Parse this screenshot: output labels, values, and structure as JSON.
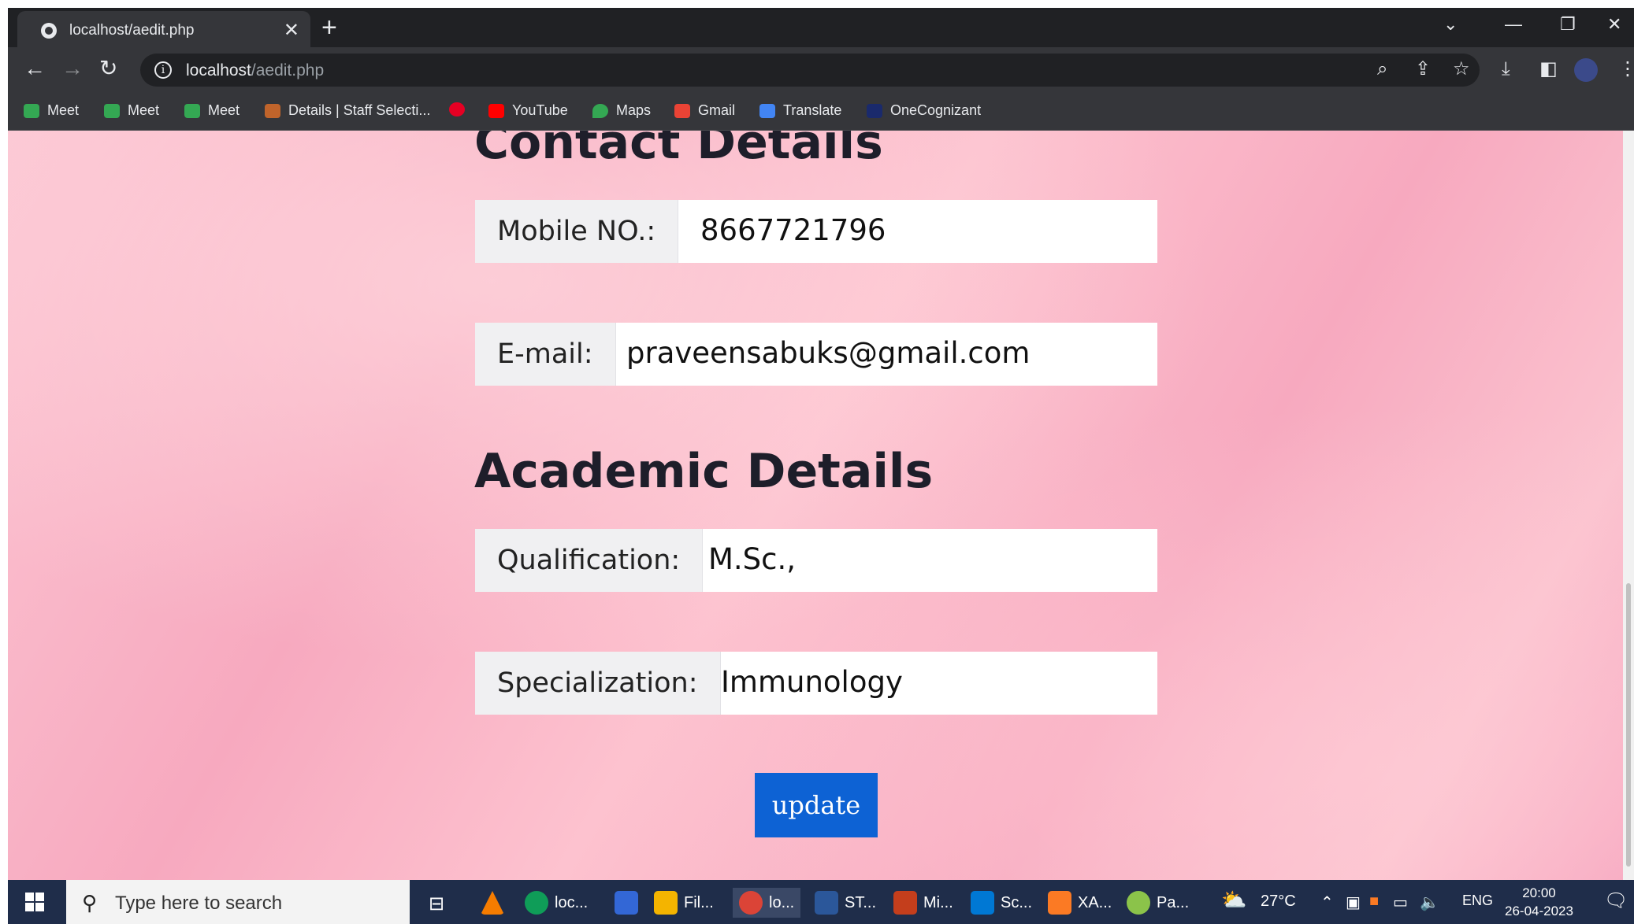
{
  "browser": {
    "tab_title": "localhost/aedit.php",
    "tab_close": "✕",
    "new_tab": "+",
    "url_host": "localhost",
    "url_path": "/aedit.php",
    "window_controls": {
      "tab_search": "⌄",
      "minimize": "—",
      "restore": "❐",
      "close": "✕"
    },
    "toolbar_icons": [
      "zoom-icon",
      "share-icon",
      "star-icon",
      "download-icon",
      "sidebar-icon",
      "profile-avatar",
      "menu-icon"
    ],
    "bookmarks": [
      {
        "label": "Meet",
        "color": "#34a853"
      },
      {
        "label": "Meet",
        "color": "#34a853"
      },
      {
        "label": "Meet",
        "color": "#34a853"
      },
      {
        "label": "Details | Staff Selecti...",
        "color": "#c0642b"
      },
      {
        "label": "",
        "color": "#e60023"
      },
      {
        "label": "YouTube",
        "color": "#ff0000"
      },
      {
        "label": "Maps",
        "color": "#34a853"
      },
      {
        "label": "Gmail",
        "color": "#ea4335"
      },
      {
        "label": "Translate",
        "color": "#4285f4"
      },
      {
        "label": "OneCognizant",
        "color": "#1a2a6c"
      }
    ]
  },
  "page": {
    "contact_heading": "Contact Details",
    "mobile_label": "Mobile NO.:",
    "mobile_value": "8667721796",
    "email_label": "E-mail:",
    "email_value": "praveensabuks@gmail.com",
    "academic_heading": "Academic Details",
    "qualification_label": "Qualification:",
    "qualification_value": "M.Sc.,",
    "specialization_label": "Specialization:",
    "specialization_value": "Immunology",
    "update_button": "update",
    "button_color": "#0d62d4"
  },
  "taskbar": {
    "search_placeholder": "Type here to search",
    "apps": [
      {
        "label": "",
        "color": "#f57c00",
        "active": false
      },
      {
        "label": "loc...",
        "color": "#0f9d58",
        "active": false
      },
      {
        "label": "",
        "color": "#3367d6",
        "active": false
      },
      {
        "label": "Fil...",
        "color": "#f4b400",
        "active": false
      },
      {
        "label": "lo...",
        "color": "#db4437",
        "active": true
      },
      {
        "label": "ST...",
        "color": "#2b579a",
        "active": false
      },
      {
        "label": "Mi...",
        "color": "#c43e1c",
        "active": false
      },
      {
        "label": "Sc...",
        "color": "#0078d4",
        "active": false
      },
      {
        "label": "XA...",
        "color": "#fb7a24",
        "active": false
      },
      {
        "label": "Pa...",
        "color": "#8bc34a",
        "active": false
      }
    ],
    "weather": "27°C",
    "language": "ENG",
    "time": "20:00",
    "date": "26-04-2023"
  }
}
